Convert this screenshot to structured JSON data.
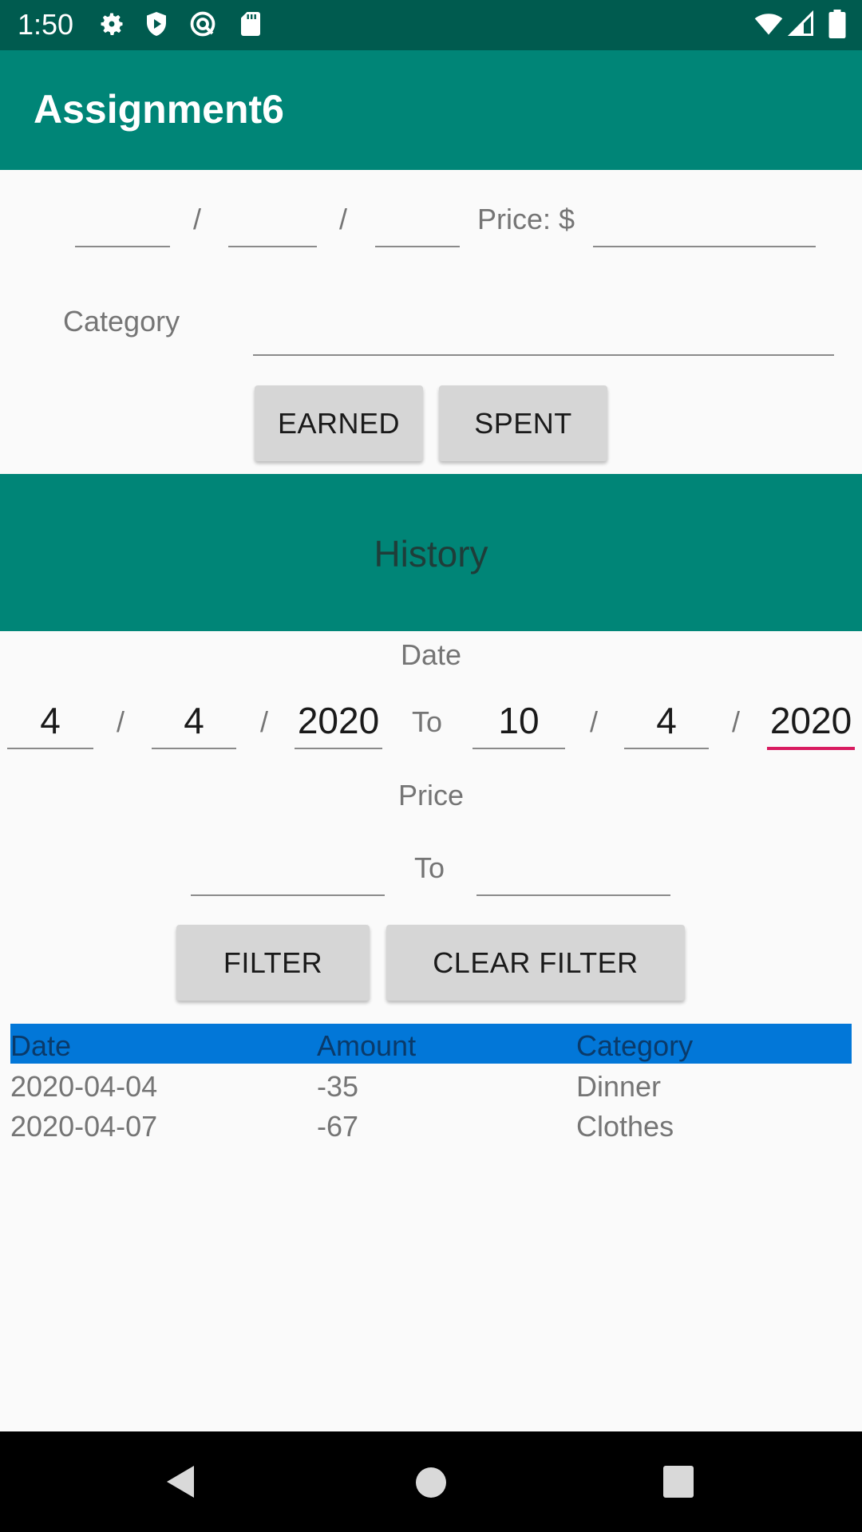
{
  "status_bar": {
    "time": "1:50",
    "left_icons": [
      "gear-icon",
      "shield-icon",
      "vpn-icon",
      "sd-card-icon"
    ],
    "right_icons": [
      "wifi-icon",
      "cell-signal-icon",
      "battery-icon"
    ]
  },
  "app_bar": {
    "title": "Assignment6"
  },
  "entry_form": {
    "date_separator": "/",
    "price_label": "Price: $",
    "category_label": "Category",
    "earned_button": "EARNED",
    "spent_button": "SPENT"
  },
  "history": {
    "title": "History",
    "date_label": "Date",
    "from_month": "4",
    "from_day": "4",
    "from_year": "2020",
    "to_label": "To",
    "to_month": "10",
    "to_day": "4",
    "to_year": "2020",
    "price_label": "Price",
    "price_to_label": "To",
    "filter_button": "FILTER",
    "clear_filter_button": "CLEAR FILTER"
  },
  "table": {
    "columns": [
      "Date",
      "Amount",
      "Category"
    ],
    "rows": [
      [
        "2020-04-04",
        "-35",
        "Dinner"
      ],
      [
        "2020-04-07",
        "-67",
        "Clothes"
      ]
    ]
  },
  "colors": {
    "primary": "#008577",
    "primary_dark": "#005b4f",
    "accent": "#d81b60",
    "table_header": "#0277d8"
  },
  "nav_bar": {
    "buttons": [
      "back-icon",
      "home-icon",
      "recents-icon"
    ]
  }
}
